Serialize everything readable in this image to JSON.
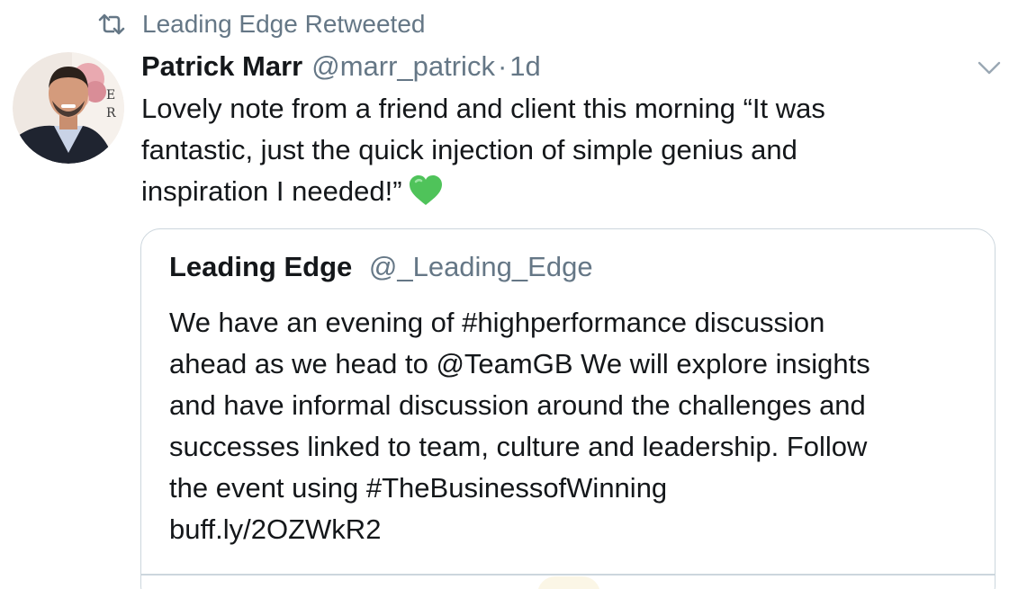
{
  "retweet_context": {
    "icon": "retweet-icon",
    "text": "Leading Edge Retweeted"
  },
  "tweet": {
    "avatar_icon": "avatar-photo",
    "author_name": "Patrick Marr",
    "author_handle": "@marr_patrick",
    "separator": "·",
    "timestamp": "1d",
    "menu_icon": "chevron-down-icon",
    "text_lines": [
      "Lovely note from a friend and client this morning “It was",
      "fantastic, just the quick injection of simple genius and",
      "inspiration I needed!”"
    ],
    "emoji": "green-heart-icon"
  },
  "quoted_tweet": {
    "author_name": "Leading Edge",
    "author_handle": "@_Leading_Edge",
    "text_lines": [
      "We have an evening of #highperformance discussion",
      "ahead as we head to @TeamGB  We will explore insights",
      "and have informal discussion around the challenges and",
      "successes linked to team, culture and leadership. Follow",
      "the event using  #TheBusinessofWinning",
      "buff.ly/2OZWkR2"
    ]
  },
  "colors": {
    "text_primary": "#14171a",
    "text_secondary": "#657786",
    "border": "#ccd6dd",
    "heart_green": "#4fc35a"
  }
}
